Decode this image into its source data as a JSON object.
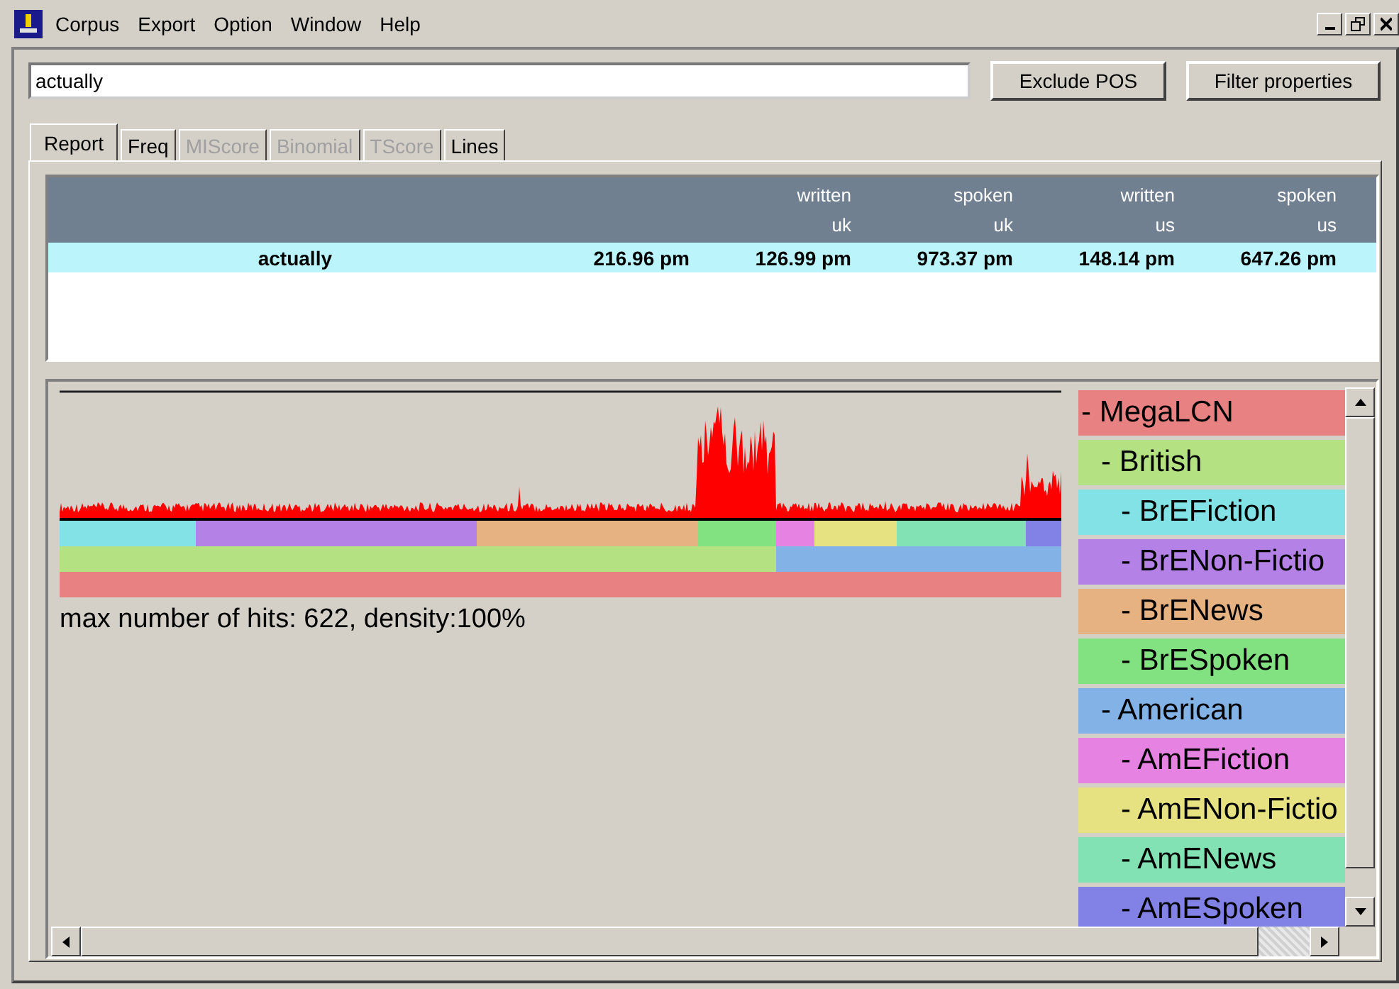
{
  "menu": [
    "Corpus",
    "Export",
    "Option",
    "Window",
    "Help"
  ],
  "search": {
    "value": "actually"
  },
  "buttons": [
    "Exclude POS",
    "Filter properties"
  ],
  "tabs": [
    {
      "label": "Report",
      "selected": true,
      "disabled": false
    },
    {
      "label": "Freq",
      "selected": false,
      "disabled": false
    },
    {
      "label": "MIScore",
      "selected": false,
      "disabled": true
    },
    {
      "label": "Binomial",
      "selected": false,
      "disabled": true
    },
    {
      "label": "TScore",
      "selected": false,
      "disabled": true
    },
    {
      "label": "Lines",
      "selected": false,
      "disabled": false
    }
  ],
  "table": {
    "columns": [
      {
        "line_1": "written",
        "line_2": "uk"
      },
      {
        "line_1": "spoken",
        "line_2": "uk"
      },
      {
        "line_1": "written",
        "line_2": "us"
      },
      {
        "line_1": "spoken",
        "line_2": "us"
      }
    ],
    "rows": [
      {
        "word": "actually",
        "total": "216.96 pm",
        "values": [
          "126.99 pm",
          "973.37 pm",
          "148.14 pm",
          "647.26 pm"
        ],
        "selected": true
      }
    ]
  },
  "distribution": {
    "caption": "max number of hits: 622, density:100%"
  },
  "tree": [
    {
      "label": "- MegaLCN",
      "color": "#e88282",
      "children": [
        {
          "label": "- British",
          "color": "#b4e282",
          "children": [
            {
              "label": "- BrEFiction",
              "color": "#82e2e6"
            },
            {
              "label": "- BrENon-Fictio",
              "color": "#b482e6"
            },
            {
              "label": "- BrENews",
              "color": "#e6b282"
            },
            {
              "label": "- BrESpoken",
              "color": "#82e282"
            }
          ]
        },
        {
          "label": "- American",
          "color": "#82b2e6",
          "children": [
            {
              "label": "- AmEFiction",
              "color": "#e682e2"
            },
            {
              "label": "- AmENon-Fictio",
              "color": "#e6e282"
            },
            {
              "label": "- AmENews",
              "color": "#82e2b4"
            },
            {
              "label": "- AmESpoken",
              "color": "#8282e6"
            }
          ]
        }
      ]
    }
  ]
}
